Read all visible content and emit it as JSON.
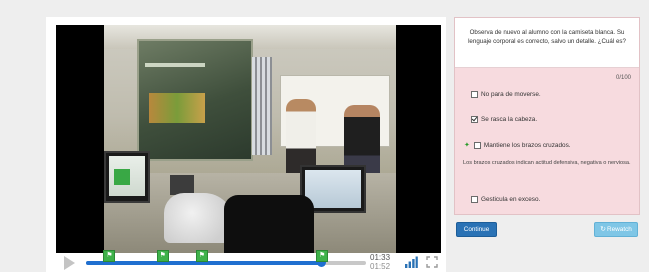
{
  "player": {
    "progress": 0.84,
    "markers": [
      {
        "position": 0.08,
        "icon": "flag-icon"
      },
      {
        "position": 0.27,
        "icon": "flag-icon"
      },
      {
        "position": 0.41,
        "icon": "flag-icon"
      },
      {
        "position": 0.84,
        "icon": "flag-icon"
      }
    ],
    "current_time": "01:33",
    "duration": "01:52"
  },
  "question": {
    "prompt": "Observa de nuevo al alumno con la camiseta blanca. Su lenguaje corporal es correcto, salvo un detalle. ¿Cuál es?",
    "score": "0/100",
    "options": [
      {
        "label": "No para de moverse.",
        "checked": false,
        "selected": false
      },
      {
        "label": "Se rasca la cabeza.",
        "checked": true,
        "selected": false
      },
      {
        "label": "Mantiene los brazos cruzados.",
        "checked": false,
        "selected": true
      },
      {
        "label": "Gesticula en exceso.",
        "checked": false,
        "selected": false
      }
    ],
    "feedback": "Los brazos cruzados indican actitud defensiva, negativa o nerviosa."
  },
  "buttons": {
    "continue_label": "Continue",
    "rewatch_label": "Rewatch"
  },
  "colors": {
    "accent_blue": "#2a72b5",
    "marker_green": "#3fb24a",
    "panel_pink": "#f7dbdf",
    "rewatch_blue": "#7fc6e6"
  }
}
